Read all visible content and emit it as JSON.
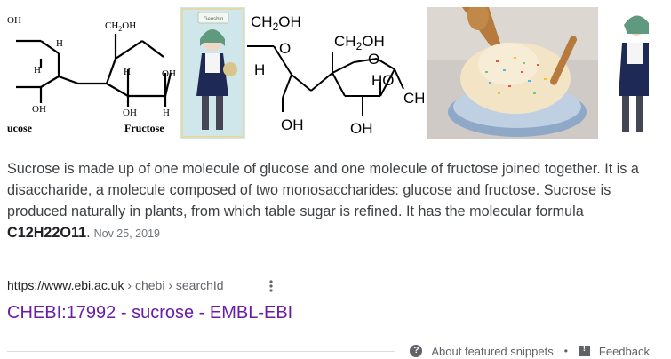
{
  "images": {
    "first": {
      "formula_top": "OH",
      "formula_ch2oh": "CH",
      "formula_ch2oh_sub": "2",
      "formula_ch2oh_end": "OH",
      "labels": [
        "H",
        "H",
        "OH",
        "H",
        "OH",
        "OH",
        "H"
      ],
      "caption_left": "ucose",
      "caption_right": "Fructose"
    },
    "second": {
      "badge": "Genshin"
    },
    "third": {
      "label_top": "CH",
      "label_top_sub": "2",
      "label_top_end": "OH",
      "label_ch2oh": "CH",
      "label_ch2oh_sub": "2",
      "label_ch2oh_end": "OH",
      "label_o": "O",
      "label_h": "H",
      "label_ho": "HO",
      "label_ch": "CH",
      "label_oh_left": "OH",
      "label_oh_right": "OH"
    }
  },
  "snippet": {
    "text": "Sucrose is made up of one molecule of glucose and one molecule of fructose joined together. It is a disaccharide, a molecule composed of two monosaccharides: glucose and fructose. Sucrose is produced naturally in plants, from which table sugar is refined. It has the molecular formula ",
    "formula": "C12H22O11",
    "period": ".",
    "date": "Nov 25, 2019"
  },
  "source": {
    "domain": "https://www.ebi.ac.uk",
    "crumbs": " › chebi › searchId"
  },
  "result": {
    "title": "CHEBI:17992 - sucrose - EMBL-EBI"
  },
  "footer": {
    "about_label": "About featured snippets",
    "separator": "•",
    "feedback_label": "Feedback"
  },
  "colors": {
    "link_visited": "#681da8",
    "text": "#3c4043",
    "muted": "#70757a"
  }
}
